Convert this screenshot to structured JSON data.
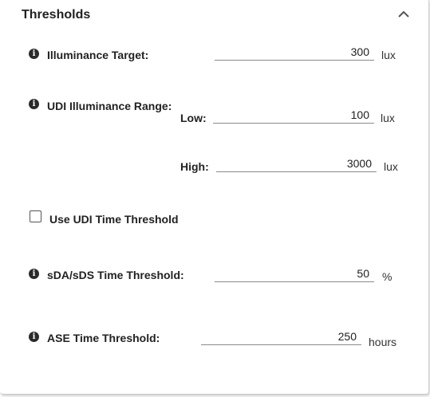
{
  "section": {
    "title": "Thresholds",
    "collapse_icon": "chevron-up-icon"
  },
  "illuminance_target": {
    "label": "Illuminance Target:",
    "value": "300",
    "unit": "lux",
    "info_icon": "info-icon"
  },
  "udi_range": {
    "label": "UDI Illuminance Range:",
    "info_icon": "info-icon",
    "low": {
      "label": "Low:",
      "value": "100",
      "unit": "lux"
    },
    "high": {
      "label": "High:",
      "value": "3000",
      "unit": "lux"
    }
  },
  "udi_time_threshold": {
    "label": "Use UDI Time Threshold",
    "checked": false
  },
  "sda_sds_threshold": {
    "label": "sDA/sDS Time Threshold:",
    "value": "50",
    "unit": "%",
    "info_icon": "info-icon"
  },
  "ase_threshold": {
    "label": "ASE Time Threshold:",
    "value": "250",
    "unit": "hours",
    "info_icon": "info-icon"
  }
}
